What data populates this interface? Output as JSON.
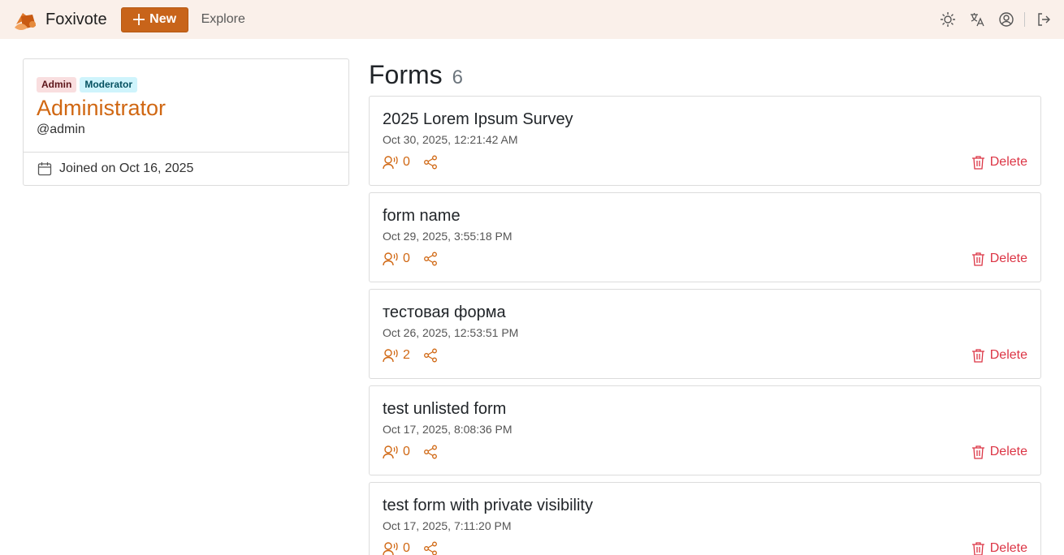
{
  "nav": {
    "brand": "Foxivote",
    "new_label": "New",
    "explore_label": "Explore",
    "icons": [
      "sun-icon",
      "translate-icon",
      "user-circle-icon",
      "logout-icon"
    ]
  },
  "profile": {
    "badges": [
      "Admin",
      "Moderator"
    ],
    "name": "Administrator",
    "handle": "@admin",
    "joined": "Joined on Oct 16, 2025"
  },
  "forms": {
    "title": "Forms",
    "count": "6",
    "delete_label": "Delete",
    "items": [
      {
        "name": "2025 Lorem Ipsum Survey",
        "date": "Oct 30, 2025, 12:21:42 AM",
        "responses": "0"
      },
      {
        "name": "form name",
        "date": "Oct 29, 2025, 3:55:18 PM",
        "responses": "0"
      },
      {
        "name": "тестовая форма",
        "date": "Oct 26, 2025, 12:53:51 PM",
        "responses": "2"
      },
      {
        "name": "test unlisted form",
        "date": "Oct 17, 2025, 8:08:36 PM",
        "responses": "0"
      },
      {
        "name": "test form with private visibility",
        "date": "Oct 17, 2025, 7:11:20 PM",
        "responses": "0"
      }
    ]
  },
  "colors": {
    "accent": "#d06712",
    "topbar_bg": "#faf0ea",
    "danger": "#dc3545"
  }
}
